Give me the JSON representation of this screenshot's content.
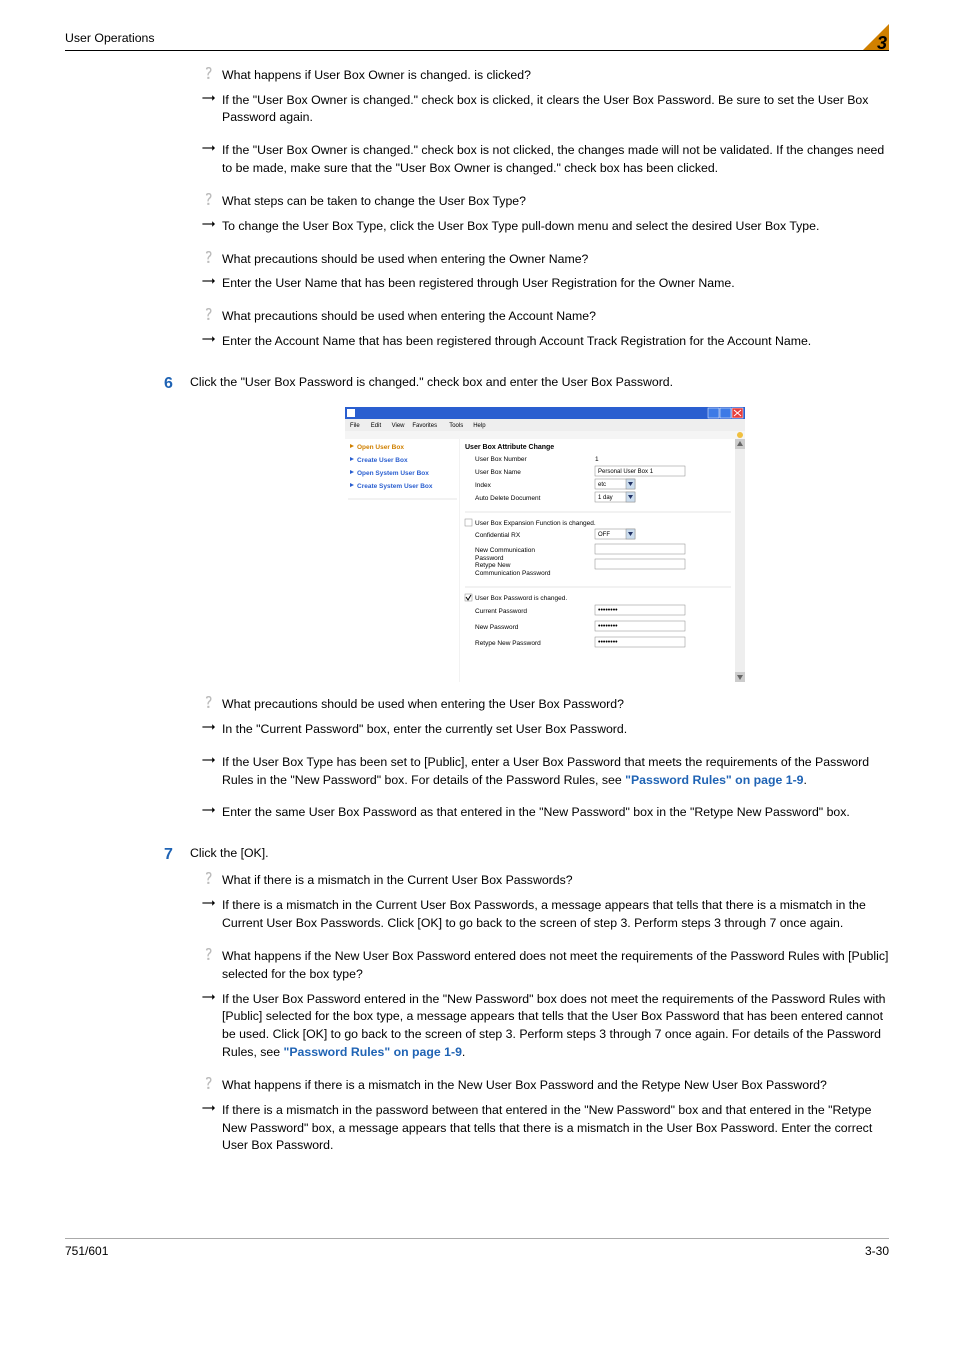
{
  "header": {
    "breadcrumb": "User Operations",
    "chapter": "3"
  },
  "items": [
    {
      "kind": "q",
      "text": "What happens if User Box Owner is changed. is clicked?"
    },
    {
      "kind": "a",
      "text": "If the \"User Box Owner is changed.\" check box is clicked, it clears the User Box Password. Be sure to set the User Box Password again."
    },
    {
      "kind": "a",
      "gap": true,
      "text": "If the \"User Box Owner is changed.\" check box is not clicked, the changes made will not be validated. If the changes need to be made, make sure that the \"User Box Owner is changed.\" check box has been clicked."
    },
    {
      "kind": "q",
      "gap": true,
      "text": "What steps can be taken to change the User Box Type?"
    },
    {
      "kind": "a",
      "text": "To change the User Box Type, click the User Box Type pull-down menu and select the desired User Box Type."
    },
    {
      "kind": "q",
      "gap": true,
      "text": "What precautions should be used when entering the Owner Name?"
    },
    {
      "kind": "a",
      "text": "Enter the User Name that has been registered through User Registration for the Owner Name."
    },
    {
      "kind": "q",
      "gap": true,
      "text": "What precautions should be used when entering the Account Name?"
    },
    {
      "kind": "a",
      "text": "Enter the Account Name that has been registered through Account Track Registration for the Account Name."
    }
  ],
  "step6": {
    "num": "6",
    "text": "Click the \"User Box Password is changed.\" check box and enter the User Box Password."
  },
  "screenshot": {
    "menubar": [
      "File",
      "Edit",
      "View",
      "Favorites",
      "Tools",
      "Help"
    ],
    "sidebar": [
      "Open User Box",
      "Create User Box",
      "Open System User Box",
      "Create System User Box"
    ],
    "main_title": "User Box Attribute Change",
    "rows": [
      {
        "label": "User Box Number",
        "value": "1"
      },
      {
        "label": "User Box Name",
        "input": "Personal User Box 1"
      },
      {
        "label": "Index",
        "select": "etc"
      },
      {
        "label": "Auto Delete Document",
        "select": "1 day"
      }
    ],
    "sec_expansion": {
      "checkbox_label": "User Box Expansion Function is changed.",
      "rows": [
        {
          "label": "Confidential RX",
          "select": "OFF"
        },
        {
          "label": "New Communication Password",
          "input": ""
        },
        {
          "label": "Retype New Communication Password",
          "input": ""
        }
      ]
    },
    "sec_password": {
      "checkbox_label": "User Box Password is changed.",
      "rows": [
        {
          "label": "Current Password",
          "pw": "••••••••"
        },
        {
          "label": "New Password",
          "pw": "••••••••"
        },
        {
          "label": "Retype New Password",
          "pw": "••••••••"
        }
      ]
    }
  },
  "items2": [
    {
      "kind": "q",
      "text": "What precautions should be used when entering the User Box Password?"
    },
    {
      "kind": "a",
      "text": "In the \"Current Password\" box, enter the currently set User Box Password."
    },
    {
      "kind": "a",
      "gap": true,
      "html": "If the User Box Type has been set to [Public], enter a User Box Password that meets the requirements of the Password Rules in the \"New Password\" box. For details of the Password Rules, see <span class=\"link\">\"Password Rules\" on page 1-9</span>."
    },
    {
      "kind": "a",
      "gap": true,
      "text": "Enter the same User Box Password as that entered in the \"New Password\" box in the \"Retype New Password\" box."
    }
  ],
  "step7": {
    "num": "7",
    "text": "Click the [OK]."
  },
  "items3": [
    {
      "kind": "q",
      "text": "What if there is a mismatch in the Current User Box Passwords?"
    },
    {
      "kind": "a",
      "text": "If there is a mismatch in the Current User Box Passwords, a message appears that tells that there is a mismatch in the Current User Box Passwords. Click [OK] to go back to the screen of step 3. Perform steps 3 through 7 once again."
    },
    {
      "kind": "q",
      "gap": true,
      "text": "What happens if the New User Box Password entered does not meet the requirements of the Password Rules with [Public] selected for the box type?"
    },
    {
      "kind": "a",
      "html": "If the User Box Password entered in the \"New Password\" box does not meet the requirements of the Password Rules with [Public] selected for the box type, a message appears that tells that the User Box Password that has been entered cannot be used. Click [OK] to go back to the screen of step 3. Perform steps 3 through 7 once again. For details of the Password Rules, see <span class=\"link\">\"Password Rules\" on page 1-9</span>."
    },
    {
      "kind": "q",
      "gap": true,
      "text": "What happens if there is a mismatch in the New User Box Password and the Retype New User Box Password?"
    },
    {
      "kind": "a",
      "text": "If there is a mismatch in the password between that entered in the \"New Password\" box and that entered in the \"Retype New Password\" box, a message appears that tells that there is a mismatch in the User Box Password. Enter the correct User Box Password."
    }
  ],
  "footer": {
    "left": "751/601",
    "right": "3-30"
  }
}
